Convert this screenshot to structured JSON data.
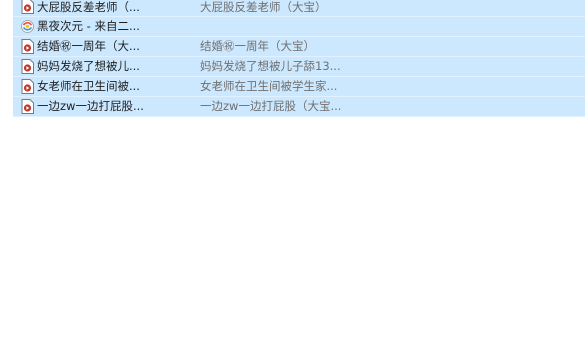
{
  "files": [
    {
      "name": "大屁股反差老师（...",
      "title": "大屁股反差老师（大宝）",
      "icon": "video-file-icon"
    },
    {
      "name": "黑夜次元 - 来自二...",
      "title": "",
      "icon": "app-shortcut-icon"
    },
    {
      "name": "结婚㊗一周年（大...",
      "title": "结婚㊗一周年（大宝）",
      "icon": "video-file-icon"
    },
    {
      "name": "妈妈发烧了想被儿...",
      "title": "妈妈发烧了想被儿子舔13...",
      "icon": "video-file-icon"
    },
    {
      "name": "女老师在卫生间被...",
      "title": "女老师在卫生间被学生家...",
      "icon": "video-file-icon"
    },
    {
      "name": "一边zw一边打屁股...",
      "title": "一边zw一边打屁股（大宝...",
      "icon": "video-file-icon"
    }
  ],
  "colors": {
    "selected_row_bg": "#cce8ff",
    "name_text": "#1f1f1f",
    "title_text": "#707070"
  }
}
